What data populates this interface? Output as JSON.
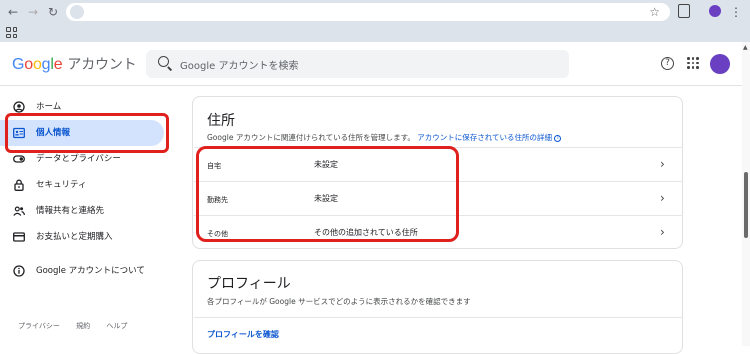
{
  "browser": {
    "back": "←",
    "forward": "→",
    "reload": "↻",
    "star": "☆",
    "menu": "⋮"
  },
  "header": {
    "logo": {
      "g": "G",
      "o1": "o",
      "o2": "o",
      "g2": "g",
      "l": "l",
      "e": "e",
      "product": "アカウント"
    },
    "search_placeholder": "Google アカウントを検索",
    "help": "?"
  },
  "sidebar": {
    "items": [
      {
        "label": "ホーム",
        "icon": "home-icon"
      },
      {
        "label": "個人情報",
        "icon": "id-card-icon",
        "active": true
      },
      {
        "label": "データとプライバシー",
        "icon": "toggle-icon"
      },
      {
        "label": "セキュリティ",
        "icon": "lock-icon"
      },
      {
        "label": "情報共有と連絡先",
        "icon": "people-icon"
      },
      {
        "label": "お支払いと定期購入",
        "icon": "credit-card-icon"
      },
      {
        "label": "Google アカウントについて",
        "icon": "info-icon"
      }
    ],
    "footer": [
      "プライバシー",
      "規約",
      "ヘルプ"
    ]
  },
  "address_card": {
    "title": "住所",
    "desc": "Google アカウントに関連付けられている住所を管理します。",
    "link": "アカウントに保存されている住所の詳細",
    "rows": [
      {
        "type": "自宅",
        "value": "未設定"
      },
      {
        "type": "勤務先",
        "value": "未設定"
      },
      {
        "type": "その他",
        "value": "その他の追加されている住所"
      }
    ]
  },
  "profile_card": {
    "title": "プロフィール",
    "desc": "各プロフィールが Google サービスでどのように表示されるかを確認できます",
    "link": "プロフィールを確認"
  },
  "colors": {
    "accent": "#0b57d0",
    "active_bg": "#d3e3fd",
    "highlight": "#e0201c",
    "avatar": "#6a3fc1"
  }
}
